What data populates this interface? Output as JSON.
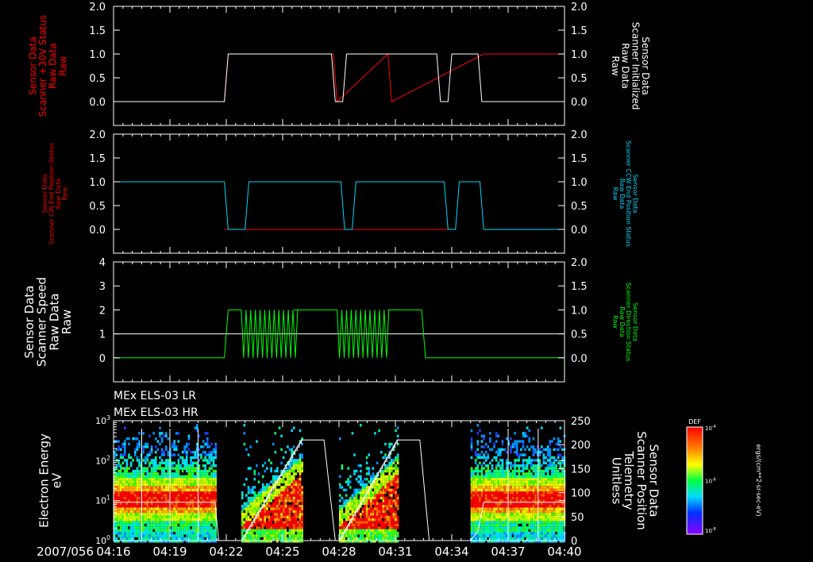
{
  "time_axis": {
    "date_prefix": "2007/056",
    "start_min": 256,
    "end_min": 280,
    "tick_labels": [
      "04:16",
      "04:19",
      "04:22",
      "04:25",
      "04:28",
      "04:31",
      "04:34",
      "04:37",
      "04:40"
    ],
    "tick_minutes": [
      256,
      259,
      262,
      265,
      268,
      271,
      274,
      277,
      280
    ]
  },
  "colors": {
    "white": "#ffffff",
    "red": "#ff0000",
    "cyan": "#00d8ff",
    "green": "#00ff00"
  },
  "chart_data": [
    {
      "type": "line",
      "panel": 1,
      "left_axis": {
        "label_lines": [
          "Sensor Data",
          "Scanner +30V Status",
          "Raw Data",
          "Raw"
        ],
        "color": "#ff0000",
        "ylim": [
          -0.5,
          2.0
        ],
        "ticks": [
          0.0,
          0.5,
          1.0,
          1.5,
          2.0
        ],
        "tick_labels": [
          "0.0",
          "0.5",
          "1.0",
          "1.5",
          "2.0"
        ]
      },
      "right_axis": {
        "label_lines": [
          "Sensor Data",
          "Scanner Initialized",
          "Raw Data",
          "Raw"
        ],
        "color": "#ffffff",
        "ylim": [
          -0.5,
          2.0
        ],
        "ticks": [
          0.0,
          0.5,
          1.0,
          1.5,
          2.0
        ],
        "tick_labels": [
          "0.0",
          "0.5",
          "1.0",
          "1.5",
          "2.0"
        ]
      },
      "series": [
        {
          "color": "#ff0000",
          "axis": "left",
          "x": [
            256,
            261.9,
            262.1,
            267.7,
            267.9,
            270.6,
            270.8,
            275.7,
            280
          ],
          "y": [
            0,
            0,
            1,
            1,
            0,
            1,
            0,
            1,
            1
          ]
        },
        {
          "color": "#ffffff",
          "axis": "right",
          "x": [
            256,
            261.9,
            262.1,
            267.6,
            267.8,
            268.2,
            268.4,
            273.2,
            273.4,
            273.8,
            274.0,
            275.4,
            275.6,
            280
          ],
          "y": [
            0,
            0,
            1,
            1,
            0,
            0,
            1,
            1,
            0,
            0,
            1,
            1,
            0,
            0
          ]
        }
      ]
    },
    {
      "type": "line",
      "panel": 2,
      "left_axis": {
        "label_lines": [
          "Sensor Data",
          "Scanner CW End Position Status",
          "Raw Data",
          "Raw"
        ],
        "color": "#ff0000",
        "ylim": [
          -0.5,
          2.0
        ],
        "ticks": [
          0.0,
          0.5,
          1.0,
          1.5,
          2.0
        ],
        "tick_labels": [
          "0.0",
          "0.5",
          "1.0",
          "1.5",
          "2.0"
        ]
      },
      "right_axis": {
        "label_lines": [
          "Sensor Data",
          "Scanner CCW End Position Status",
          "Raw Data",
          "Raw"
        ],
        "color": "#00d8ff",
        "ylim": [
          -0.5,
          2.0
        ],
        "ticks": [
          0.0,
          0.5,
          1.0,
          1.5,
          2.0
        ],
        "tick_labels": [
          "0.0",
          "0.5",
          "1.0",
          "1.5",
          "2.0"
        ]
      },
      "series": [
        {
          "color": "#ff0000",
          "axis": "left",
          "x": [
            261.9,
            262.3,
            262.8,
            268.3,
            268.5,
            268.8,
            273.8,
            274.0,
            274.2
          ],
          "y": [
            0,
            0,
            0,
            0,
            0,
            0,
            0,
            0,
            0
          ]
        },
        {
          "color": "#00d8ff",
          "axis": "right",
          "x": [
            256,
            261.9,
            262.1,
            263.0,
            263.2,
            268.1,
            268.3,
            268.7,
            268.9,
            273.6,
            273.8,
            274.2,
            274.4,
            275.5,
            275.7,
            280
          ],
          "y": [
            1,
            1,
            0,
            0,
            1,
            1,
            0,
            0,
            1,
            1,
            0,
            0,
            1,
            1,
            0,
            0
          ]
        }
      ]
    },
    {
      "type": "line",
      "panel": 3,
      "left_axis": {
        "label_lines": [
          "Sensor Data",
          "Scanner Speed",
          "Raw Data",
          "Raw"
        ],
        "color": "#ffffff",
        "ylim": [
          -1,
          4
        ],
        "ticks": [
          0,
          1,
          2,
          3,
          4
        ],
        "tick_labels": [
          "0",
          "1",
          "2",
          "3",
          "4"
        ]
      },
      "right_axis": {
        "label_lines": [
          "Sensor Data",
          "Scanner Direction Status",
          "Raw Data",
          "Raw"
        ],
        "color": "#00ff00",
        "ylim": [
          -0.5,
          2.0
        ],
        "ticks": [
          0.0,
          0.5,
          1.0,
          1.5,
          2.0
        ],
        "tick_labels": [
          "0.0",
          "0.5",
          "1.0",
          "1.5",
          "2.0"
        ]
      },
      "series": [
        {
          "color": "#ffffff",
          "axis": "left",
          "x": [
            256,
            280
          ],
          "y": [
            1,
            1
          ]
        },
        {
          "color": "#00ff00",
          "axis": "right",
          "oscillation": true,
          "segments": [
            {
              "x0": 256,
              "x1": 261.9,
              "y": 0
            },
            {
              "x0": 262.1,
              "x1": 262.8,
              "y": 1
            },
            {
              "x0": 262.8,
              "x1": 265.6,
              "osc_period": 0.25
            },
            {
              "x0": 266.8,
              "x1": 267.9,
              "y": 1
            },
            {
              "x0": 267.9,
              "x1": 270.6,
              "osc_period": 0.25
            },
            {
              "x0": 271.1,
              "x1": 272.4,
              "y": 1
            },
            {
              "x0": 272.6,
              "x1": 280,
              "y": 0
            }
          ]
        }
      ]
    },
    {
      "type": "heatmap",
      "panel": 4,
      "header_lines": [
        "MEx ELS-03 LR",
        "MEx ELS-03 HR"
      ],
      "left_axis": {
        "label_lines": [
          "Electron Energy",
          "eV"
        ],
        "color": "#ffffff",
        "scale": "log",
        "ylim": [
          1,
          1000
        ],
        "tick_labels": [
          "10^0",
          "10^1",
          "10^2",
          "10^3"
        ]
      },
      "right_axis": {
        "label_lines": [
          "Sensor Data",
          "Scanner Position",
          "Telemetry",
          "Unitless"
        ],
        "color": "#ffffff",
        "ylim": [
          0,
          250
        ],
        "ticks": [
          0,
          50,
          100,
          150,
          200,
          250
        ],
        "tick_labels": [
          "0",
          "50",
          "100",
          "150",
          "200",
          "250"
        ]
      },
      "data_blocks": [
        {
          "x0": 256,
          "x1": 261.4,
          "kind": "steady"
        },
        {
          "x0": 262.8,
          "x1": 266.0,
          "kind": "sweep"
        },
        {
          "x0": 268.0,
          "x1": 271.1,
          "kind": "sweep"
        },
        {
          "x0": 275.0,
          "x1": 280,
          "kind": "steady"
        }
      ],
      "scanner_position": {
        "color": "#ffffff",
        "x": [
          256,
          261.4,
          261.6,
          262.8,
          266.0,
          267.2,
          267.8,
          268.0,
          271.1,
          272.3,
          272.8,
          274.0,
          275.0,
          275.4,
          275.7,
          280
        ],
        "y": [
          80,
          80,
          0,
          0,
          210,
          210,
          0,
          0,
          210,
          210,
          0,
          0,
          0,
          20,
          80,
          80
        ]
      },
      "colorbar": {
        "title": "DEF",
        "unit_label": "ergs/(cm**2-sr-sec-eV)",
        "tick_labels": [
          "10^-4",
          "10^-6",
          "10^-8"
        ]
      }
    }
  ]
}
